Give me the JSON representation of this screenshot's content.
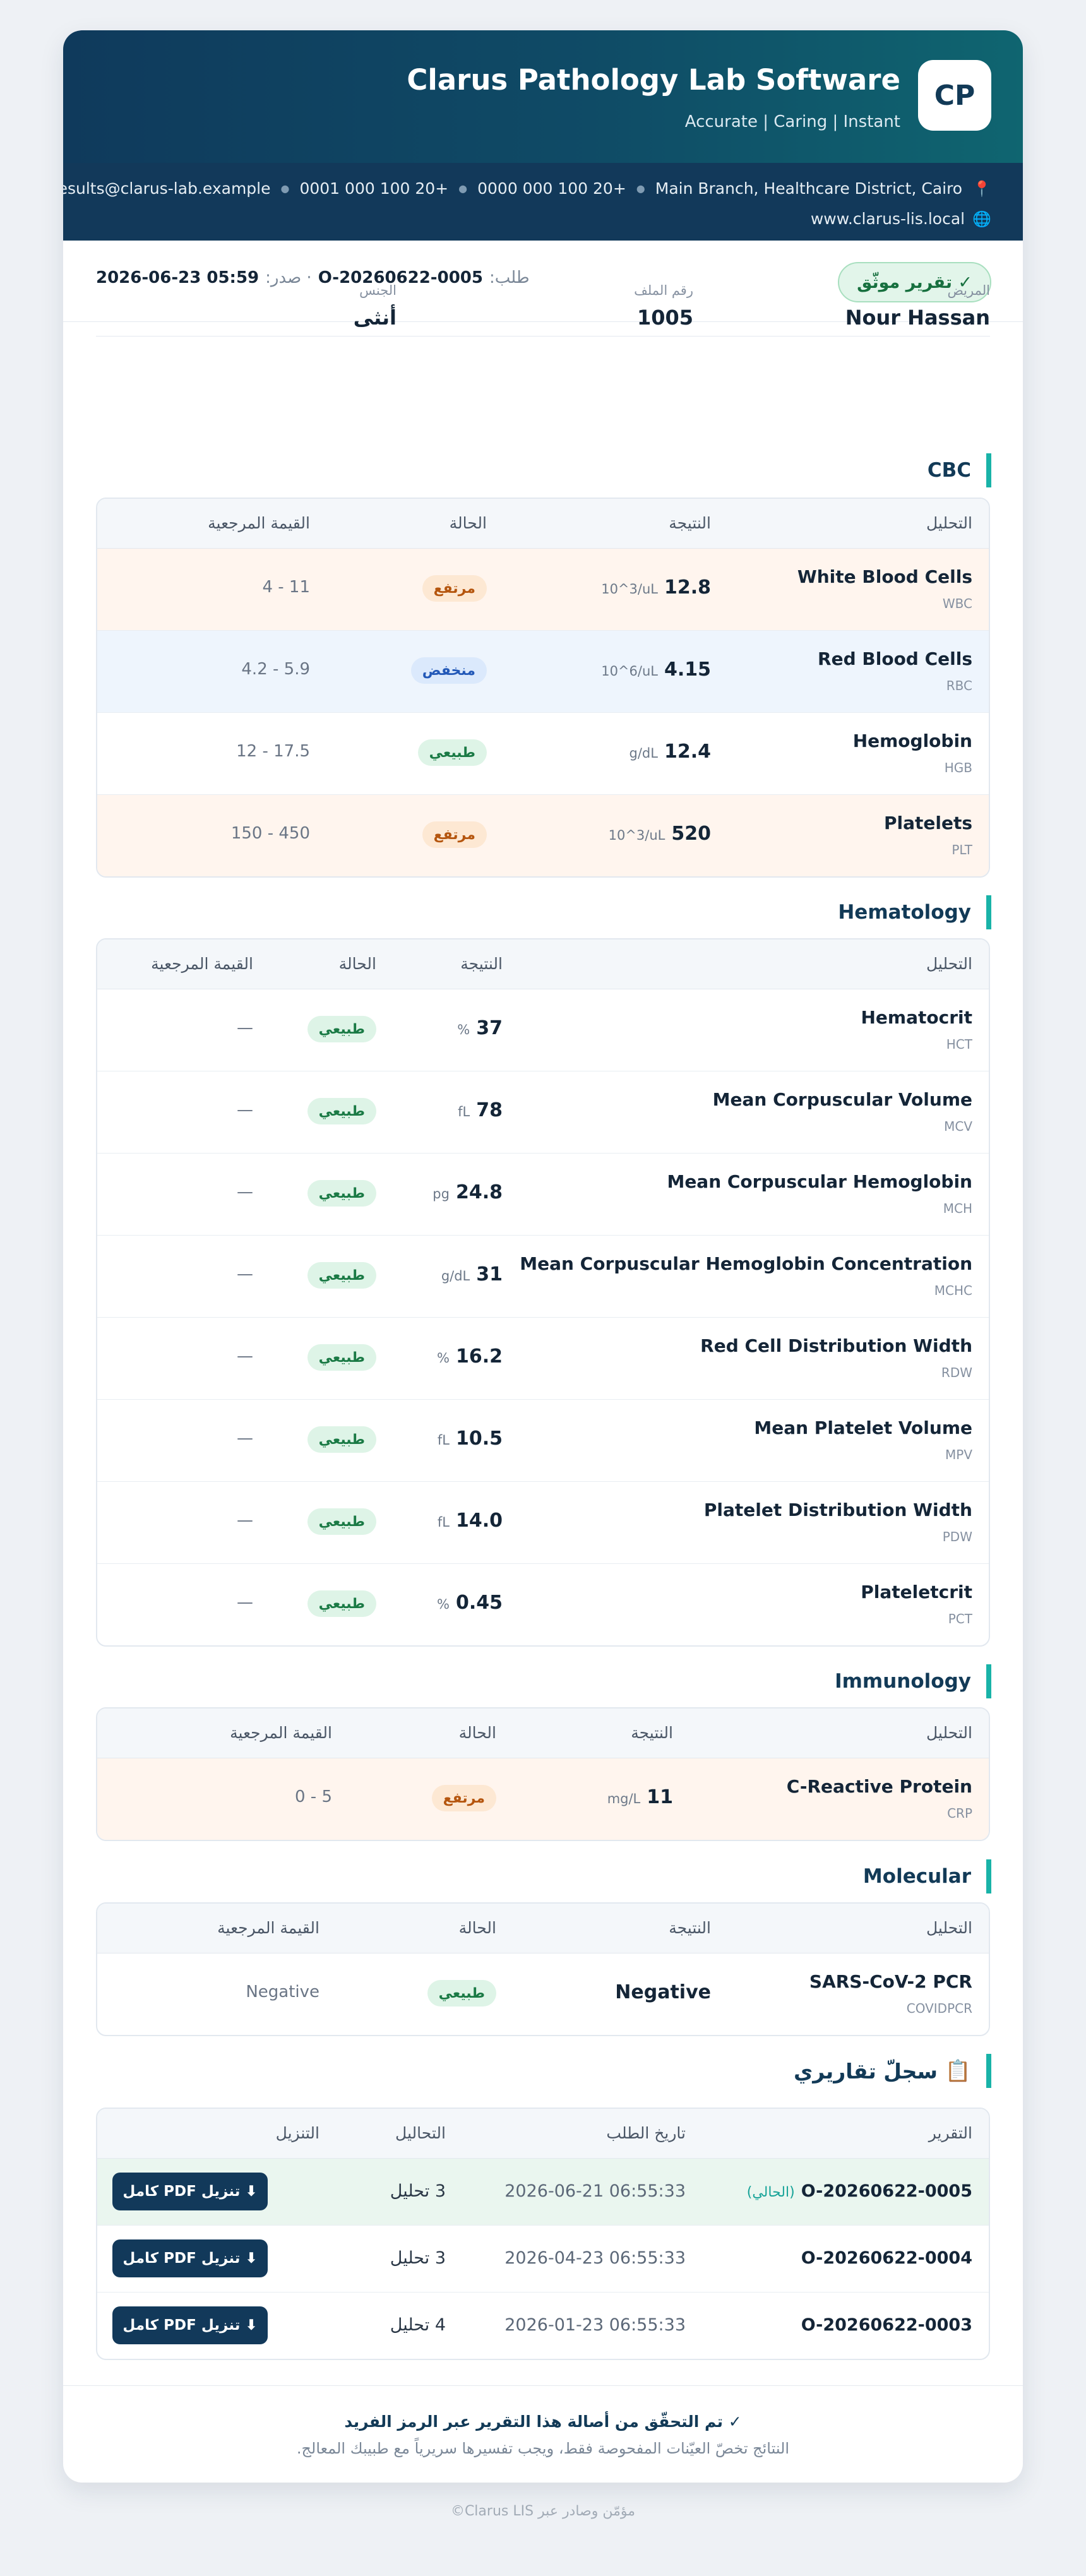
{
  "header": {
    "logo": "CP",
    "title": "Clarus Pathology Lab Software",
    "tagline": "Accurate | Caring | Instant"
  },
  "contact": {
    "address": "Main Branch, Healthcare District, Cairo",
    "phone1": "0000 000 100 20+",
    "phone2": "0001 000 100 20+",
    "email": "results@clarus-lab.example",
    "website": "www.clarus-lis.local",
    "pin_icon": "📍",
    "globe_icon": "🌐"
  },
  "meta": {
    "verified": "✓ تقرير موثّق",
    "order_label": "طلب:",
    "order_id": "O-20260622-0005",
    "issued_label": "· صدر:",
    "issued_at": "2026-06-23 05:59"
  },
  "patient": {
    "name_label": "المريض",
    "name": "Nour Hassan",
    "file_label": "رقم الملف",
    "file": "1005",
    "gender_label": "الجنس",
    "gender": "أنثى"
  },
  "columns": {
    "test": "التحليل",
    "result": "النتيجة",
    "status": "الحالة",
    "ref": "القيمة المرجعية"
  },
  "flags": {
    "high": "مرتفع",
    "low": "منخفض",
    "normal": "طبيعي"
  },
  "sections": {
    "cbc": {
      "title": "CBC",
      "rows": [
        {
          "name": "White Blood Cells",
          "code": "WBC",
          "value": "12.8",
          "unit": "10^3/uL",
          "flag": "مرتفع",
          "ref": "4 - 11"
        },
        {
          "name": "Red Blood Cells",
          "code": "RBC",
          "value": "4.15",
          "unit": "10^6/uL",
          "flag": "منخفض",
          "ref": "4.2 - 5.9"
        },
        {
          "name": "Hemoglobin",
          "code": "HGB",
          "value": "12.4",
          "unit": "g/dL",
          "flag": "طبيعي",
          "ref": "12 - 17.5"
        },
        {
          "name": "Platelets",
          "code": "PLT",
          "value": "520",
          "unit": "10^3/uL",
          "flag": "مرتفع",
          "ref": "150 - 450"
        }
      ]
    },
    "hematology": {
      "title": "Hematology",
      "rows": [
        {
          "name": "Hematocrit",
          "code": "HCT",
          "value": "37",
          "unit": "%",
          "flag": "طبيعي",
          "ref": "—"
        },
        {
          "name": "Mean Corpuscular Volume",
          "code": "MCV",
          "value": "78",
          "unit": "fL",
          "flag": "طبيعي",
          "ref": "—"
        },
        {
          "name": "Mean Corpuscular Hemoglobin",
          "code": "MCH",
          "value": "24.8",
          "unit": "pg",
          "flag": "طبيعي",
          "ref": "—"
        },
        {
          "name": "Mean Corpuscular Hemoglobin Concentration",
          "code": "MCHC",
          "value": "31",
          "unit": "g/dL",
          "flag": "طبيعي",
          "ref": "—"
        },
        {
          "name": "Red Cell Distribution Width",
          "code": "RDW",
          "value": "16.2",
          "unit": "%",
          "flag": "طبيعي",
          "ref": "—"
        },
        {
          "name": "Mean Platelet Volume",
          "code": "MPV",
          "value": "10.5",
          "unit": "fL",
          "flag": "طبيعي",
          "ref": "—"
        },
        {
          "name": "Platelet Distribution Width",
          "code": "PDW",
          "value": "14.0",
          "unit": "fL",
          "flag": "طبيعي",
          "ref": "—"
        },
        {
          "name": "Plateletcrit",
          "code": "PCT",
          "value": "0.45",
          "unit": "%",
          "flag": "طبيعي",
          "ref": "—"
        }
      ]
    },
    "immunology": {
      "title": "Immunology",
      "rows": [
        {
          "name": "C-Reactive Protein",
          "code": "CRP",
          "value": "11",
          "unit": "mg/L",
          "flag": "مرتفع",
          "ref": "0 - 5"
        }
      ]
    },
    "molecular": {
      "title": "Molecular",
      "rows": [
        {
          "name": "SARS-CoV-2 PCR",
          "code": "COVIDPCR",
          "value": "Negative",
          "unit": "",
          "flag": "طبيعي",
          "ref": "Negative"
        }
      ]
    }
  },
  "history": {
    "icon": "📋",
    "title": "سجلّ تقاريري",
    "col_report": "التقرير",
    "col_date": "تاريخ الطلب",
    "col_tests": "التحاليل",
    "col_download": "التنزيل",
    "current_label": "(الحالي)",
    "download_label": "⬇ تنزيل PDF كامل",
    "rows": [
      {
        "id": "O-20260622-0005",
        "date": "2026-06-21 06:55:33",
        "tests": "3 تحليل"
      },
      {
        "id": "O-20260622-0004",
        "date": "2026-04-23 06:55:33",
        "tests": "3 تحليل"
      },
      {
        "id": "O-20260622-0003",
        "date": "2026-01-23 06:55:33",
        "tests": "4 تحليل"
      }
    ]
  },
  "footer": {
    "verified_note": "✓ تم التحقّق من أصالة هذا التقرير عبر الرمز الفريد",
    "disclaimer": "النتائج تخصّ العيّنات المفحوصة فقط، ويجب تفسيرها سريرياً مع طبيبك المعالج.",
    "powered": "مؤمّن وصادر عبر Clarus LIS©"
  },
  "colors": {
    "primary": "#12395a",
    "accent": "#19b3a8",
    "high": "#b5560f",
    "low": "#2359b8",
    "normal": "#1a7a45"
  }
}
